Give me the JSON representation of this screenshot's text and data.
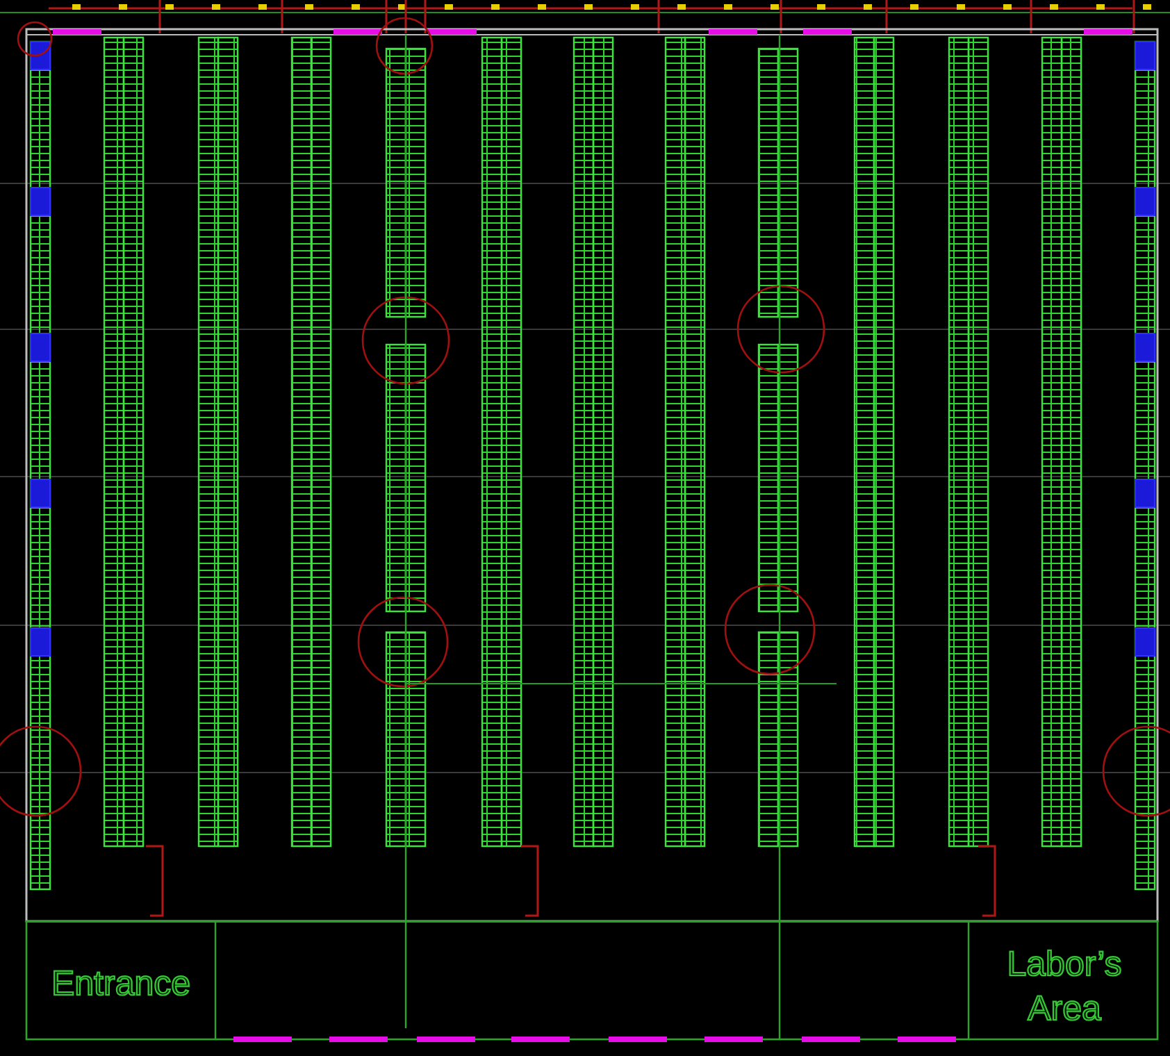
{
  "floor_plan": {
    "rooms": [
      {
        "kind": "entrance",
        "label": "Entrance"
      },
      {
        "kind": "labor",
        "label": "Labor’s Area"
      }
    ]
  }
}
